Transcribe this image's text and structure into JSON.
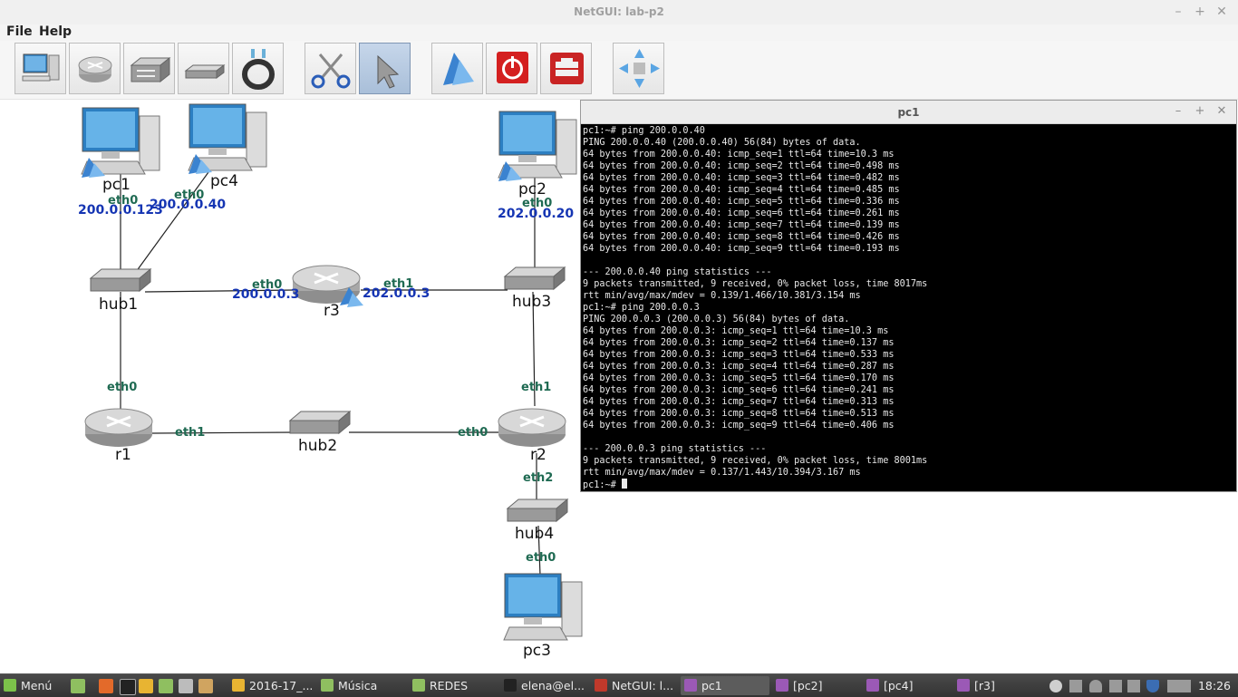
{
  "window": {
    "title": "NetGUI: lab-p2",
    "minimize": "–",
    "maximize": "+",
    "close": "✕"
  },
  "menu": {
    "file": "File",
    "help": "Help"
  },
  "toolbar": {
    "tools": [
      "add-pc",
      "add-router",
      "add-switch",
      "add-hub",
      "add-cable",
      "cut",
      "select",
      "start",
      "power-off",
      "repair",
      "move"
    ],
    "active": "select"
  },
  "network": {
    "nodes": {
      "pc1": "pc1",
      "pc4": "pc4",
      "pc2": "pc2",
      "pc3": "pc3",
      "hub1": "hub1",
      "hub2": "hub2",
      "hub3": "hub3",
      "hub4": "hub4",
      "r1": "r1",
      "r2": "r2",
      "r3": "r3"
    },
    "interfaces": {
      "pc1_eth0": "eth0",
      "pc4_eth0": "eth0",
      "pc2_eth0": "eth0",
      "pc3_eth0": "eth0",
      "r3_eth0": "eth0",
      "r3_eth1": "eth1",
      "r1_eth0": "eth0",
      "r1_eth1": "eth1",
      "r2_eth0": "eth0",
      "r2_eth1": "eth1",
      "r2_eth2": "eth2"
    },
    "addresses": {
      "pc1": "200.0.0.123",
      "pc4": "200.0.0.40",
      "pc2": "202.0.0.20",
      "r3_eth0": "200.0.0.3",
      "r3_eth1": "202.0.0.3"
    }
  },
  "terminal": {
    "title": "pc1",
    "lines": [
      "pc1:~# ping 200.0.0.40",
      "PING 200.0.0.40 (200.0.0.40) 56(84) bytes of data.",
      "64 bytes from 200.0.0.40: icmp_seq=1 ttl=64 time=10.3 ms",
      "64 bytes from 200.0.0.40: icmp_seq=2 ttl=64 time=0.498 ms",
      "64 bytes from 200.0.0.40: icmp_seq=3 ttl=64 time=0.482 ms",
      "64 bytes from 200.0.0.40: icmp_seq=4 ttl=64 time=0.485 ms",
      "64 bytes from 200.0.0.40: icmp_seq=5 ttl=64 time=0.336 ms",
      "64 bytes from 200.0.0.40: icmp_seq=6 ttl=64 time=0.261 ms",
      "64 bytes from 200.0.0.40: icmp_seq=7 ttl=64 time=0.139 ms",
      "64 bytes from 200.0.0.40: icmp_seq=8 ttl=64 time=0.426 ms",
      "64 bytes from 200.0.0.40: icmp_seq=9 ttl=64 time=0.193 ms",
      "",
      "--- 200.0.0.40 ping statistics ---",
      "9 packets transmitted, 9 received, 0% packet loss, time 8017ms",
      "rtt min/avg/max/mdev = 0.139/1.466/10.381/3.154 ms",
      "pc1:~# ping 200.0.0.3",
      "PING 200.0.0.3 (200.0.0.3) 56(84) bytes of data.",
      "64 bytes from 200.0.0.3: icmp_seq=1 ttl=64 time=10.3 ms",
      "64 bytes from 200.0.0.3: icmp_seq=2 ttl=64 time=0.137 ms",
      "64 bytes from 200.0.0.3: icmp_seq=3 ttl=64 time=0.533 ms",
      "64 bytes from 200.0.0.3: icmp_seq=4 ttl=64 time=0.287 ms",
      "64 bytes from 200.0.0.3: icmp_seq=5 ttl=64 time=0.170 ms",
      "64 bytes from 200.0.0.3: icmp_seq=6 ttl=64 time=0.241 ms",
      "64 bytes from 200.0.0.3: icmp_seq=7 ttl=64 time=0.313 ms",
      "64 bytes from 200.0.0.3: icmp_seq=8 ttl=64 time=0.513 ms",
      "64 bytes from 200.0.0.3: icmp_seq=9 ttl=64 time=0.406 ms",
      "",
      "--- 200.0.0.3 ping statistics ---",
      "9 packets transmitted, 9 received, 0% packet loss, time 8001ms",
      "rtt min/avg/max/mdev = 0.137/1.443/10.394/3.167 ms"
    ],
    "prompt": "pc1:~# "
  },
  "taskbar": {
    "menu_label": "Menú",
    "items": [
      "2016-17_...",
      "Música",
      "REDES",
      "elena@el...",
      "NetGUI: l...",
      "pc1",
      "[pc2]",
      "[pc4]",
      "[r3]"
    ],
    "active_item": "pc1",
    "clock": "18:26"
  },
  "colors": {
    "interface_label": "#1f6a52",
    "ip_label": "#1535b3",
    "terminal_bg": "#000000",
    "power_red": "#d42020"
  }
}
